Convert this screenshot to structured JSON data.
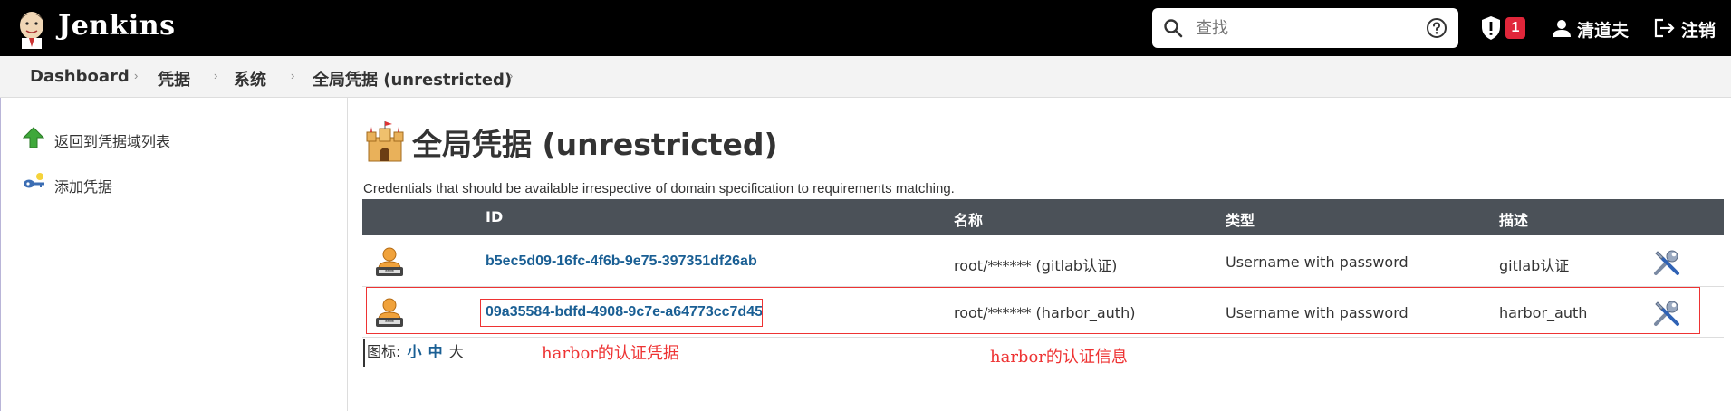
{
  "header": {
    "brand": "Jenkins",
    "search": {
      "placeholder": "查找"
    },
    "security_count": "1",
    "user_name": "清道夫",
    "logout_label": "注销"
  },
  "breadcrumb": [
    "Dashboard",
    "凭据",
    "系统",
    "全局凭据 (unrestricted)"
  ],
  "sidebar": {
    "items": [
      {
        "label": "返回到凭据域列表",
        "icon": "up-arrow-icon"
      },
      {
        "label": "添加凭据",
        "icon": "key-icon"
      }
    ]
  },
  "main": {
    "title": "全局凭据 (unrestricted)",
    "description": "Credentials that should be available irrespective of domain specification to requirements matching.",
    "table": {
      "headers": [
        "ID",
        "名称",
        "类型",
        "描述"
      ],
      "rows": [
        {
          "id": "b5ec5d09-16fc-4f6b-9e75-397351df26ab",
          "name": "root/****** (gitlab认证)",
          "type": "Username with password",
          "description": "gitlab认证"
        },
        {
          "id": "09a35584-bdfd-4908-9c7e-a64773cc7d45",
          "name": "root/****** (harbor_auth)",
          "type": "Username with password",
          "description": "harbor_auth"
        }
      ]
    },
    "icon_size": {
      "label": "图标:",
      "small": "小",
      "medium": "中",
      "large": "大"
    }
  },
  "annotations": {
    "credential_note": "harbor的认证凭据",
    "info_note": "harbor的认证信息"
  },
  "colors": {
    "header_bg": "#000000",
    "table_header_bg": "#4b5158",
    "link": "#1a5f94",
    "annotation": "#ee3333",
    "badge": "#e0263a"
  }
}
